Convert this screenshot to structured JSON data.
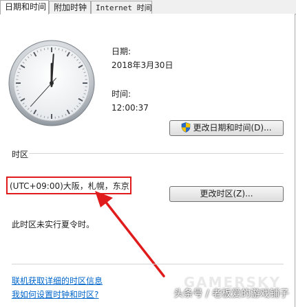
{
  "tabs": [
    {
      "label": "日期和时间",
      "active": true
    },
    {
      "label": "附加时钟",
      "active": false
    },
    {
      "label": "Internet 时间",
      "active": false
    }
  ],
  "date": {
    "label": "日期:",
    "value": "2018年3月30日"
  },
  "time": {
    "label": "时间:",
    "value": "12:00:37"
  },
  "buttons": {
    "change_datetime": "更改日期和时间(D)...",
    "change_timezone": "更改时区(Z)..."
  },
  "timezone": {
    "section_label": "时区",
    "value": "(UTC+09:00)大阪，札幌，东京",
    "dst_note": "此时区未实行夏令时。"
  },
  "links": {
    "details": "联机获取详细的时区信息",
    "help": "我如何设置时钟和时区?"
  },
  "watermark": {
    "text": "头条号 / 老板爱的游戏铺子",
    "brand": "GAMERSKY"
  },
  "colors": {
    "annotation": "#e01b1b",
    "link": "#0066cc"
  },
  "clock_reading": {
    "hour": 12,
    "minute": 0,
    "second": 37
  }
}
